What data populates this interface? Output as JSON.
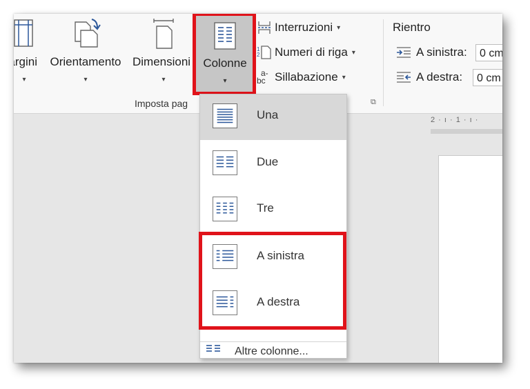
{
  "ribbon": {
    "margini_label": "argini",
    "orientamento_label": "Orientamento",
    "dimensioni_label": "Dimensioni",
    "colonne_label": "Colonne",
    "dropdown_caret": "▾",
    "group_label": "Imposta pag",
    "interruzioni_label": "Interruzioni",
    "numeri_label": "Numeri di riga",
    "sillabazione_label": "Sillabazione",
    "sillabazione_icon_text": "a-",
    "sillabazione_icon_text2": "bc",
    "launcher": "⧉"
  },
  "paragrafo": {
    "title": "Rientro",
    "left_label": "A sinistra:",
    "left_value": "0 cm",
    "right_label": "A destra:",
    "right_value": "0 cm"
  },
  "ruler": {
    "text": "2 · ı · 1 · ı ·"
  },
  "menu": {
    "items": [
      {
        "label": "Una",
        "icon": "one-column-icon",
        "selected": true
      },
      {
        "label": "Due",
        "icon": "two-columns-icon",
        "selected": false
      },
      {
        "label": "Tre",
        "icon": "three-columns-icon",
        "selected": false
      },
      {
        "label": "A sinistra",
        "icon": "left-column-icon",
        "selected": false
      },
      {
        "label": "A destra",
        "icon": "right-column-icon",
        "selected": false
      }
    ],
    "more_label": "Altre colonne..."
  },
  "colors": {
    "highlight": "#e0131a",
    "icon_blue": "#2b579a",
    "selected_bg": "#d8d8d8"
  }
}
